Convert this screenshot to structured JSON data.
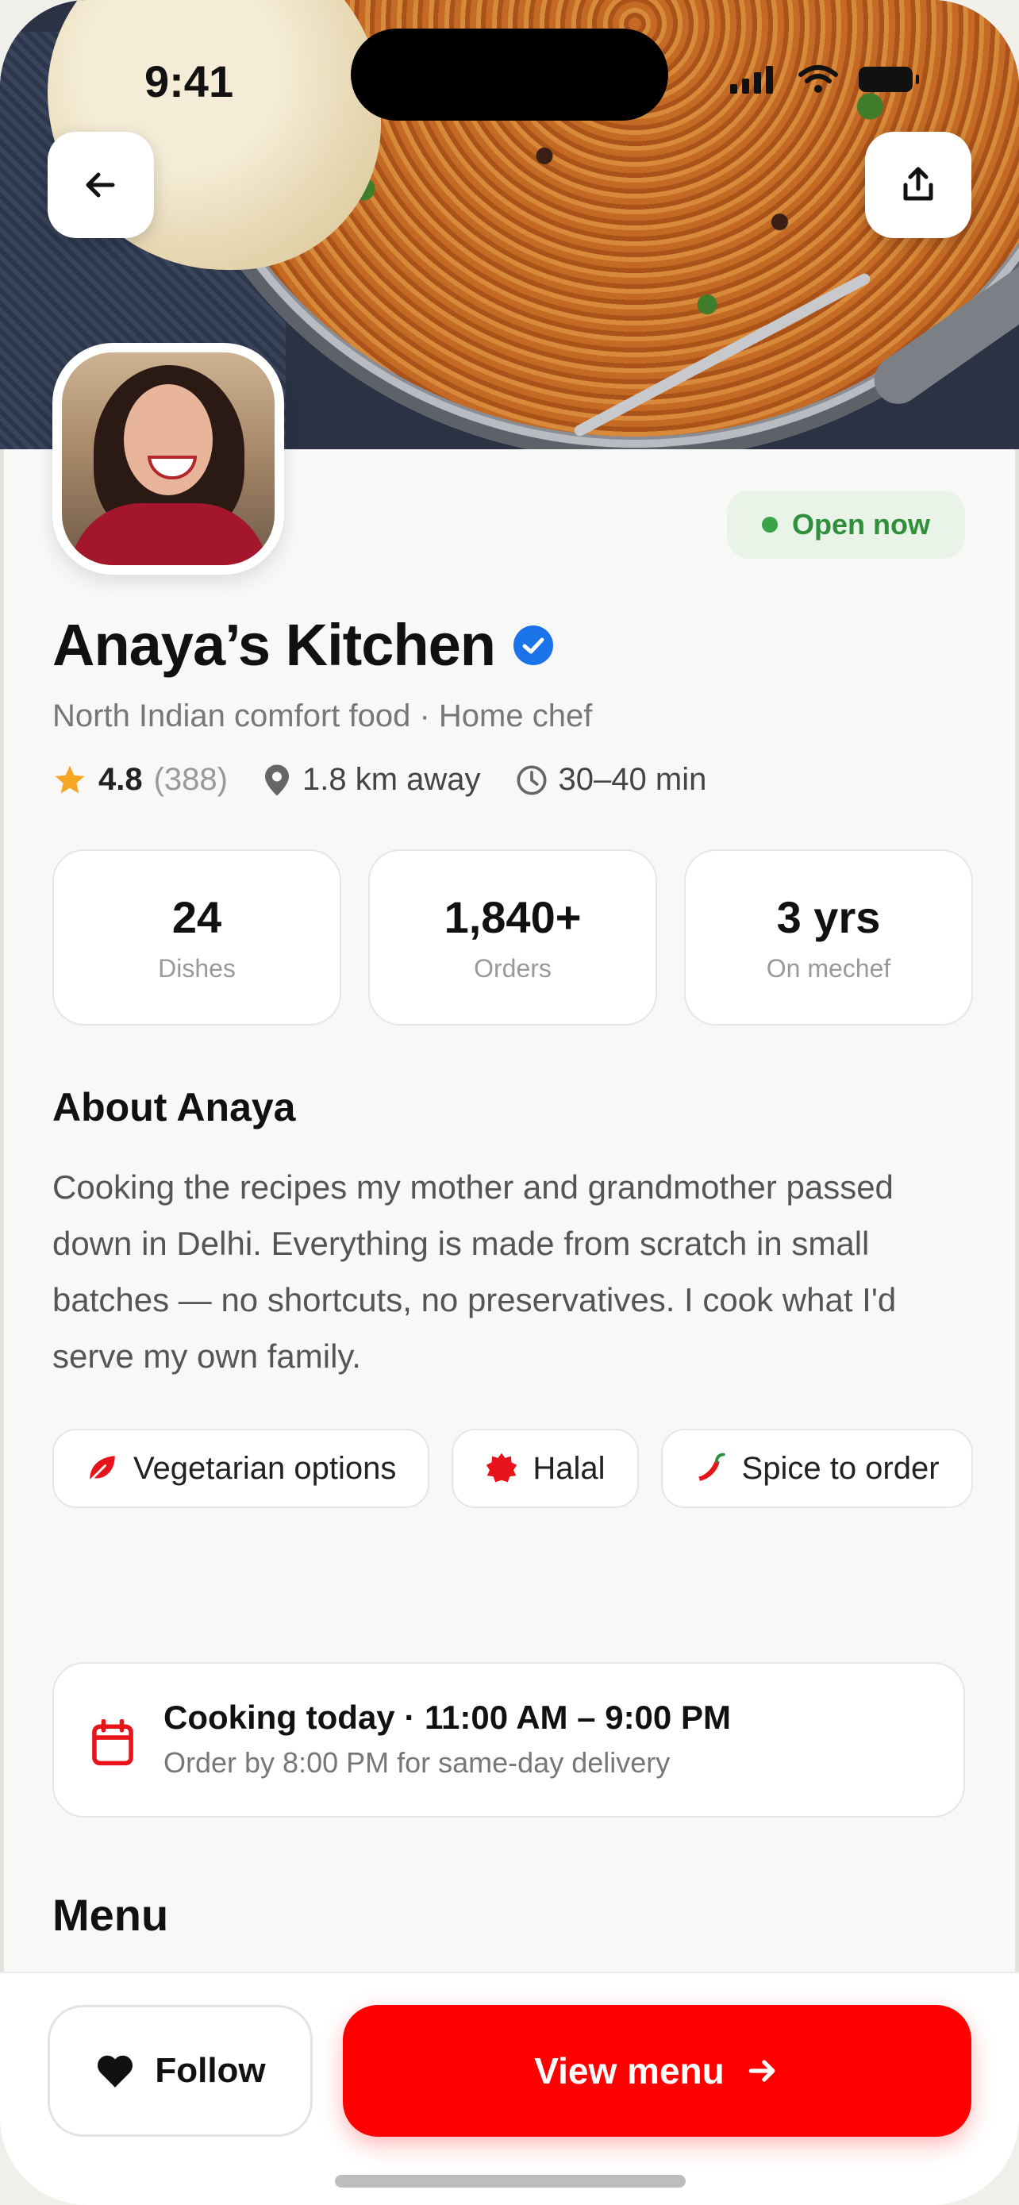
{
  "status_bar": {
    "time": "9:41"
  },
  "profile": {
    "open_status": "Open now",
    "name": "Anaya’s Kitchen",
    "subtitle": "North Indian comfort food · Home chef",
    "rating": "4.8",
    "rating_count": "(388)",
    "distance": "1.8 km away",
    "delivery_time": "30–40 min",
    "verified": true
  },
  "stats": [
    {
      "value": "24",
      "label": "Dishes"
    },
    {
      "value": "1,840+",
      "label": "Orders"
    },
    {
      "value": "3 yrs",
      "label": "On mechef"
    }
  ],
  "about": {
    "heading": "About Anaya",
    "text": "Cooking the recipes my mother and grandmother passed down in Delhi. Everything is made from scratch in small batches — no shortcuts, no preservatives. I cook what I'd serve my own family."
  },
  "tags": [
    {
      "label": "Vegetarian options",
      "icon": "leaf-icon"
    },
    {
      "label": "Halal",
      "icon": "halal-badge-icon"
    },
    {
      "label": "Spice to order",
      "icon": "chili-icon"
    }
  ],
  "schedule": {
    "title": "Cooking today · 11:00 AM – 9:00 PM",
    "subtitle": "Order by 8:00 PM for same-day delivery"
  },
  "menu": {
    "heading": "Menu"
  },
  "actions": {
    "follow_label": "Follow",
    "view_menu_label": "View menu"
  },
  "colors": {
    "accent": "#ff0000",
    "open_green": "#2f8f3a",
    "verified_blue": "#1a73e8",
    "star": "#f5a623"
  }
}
